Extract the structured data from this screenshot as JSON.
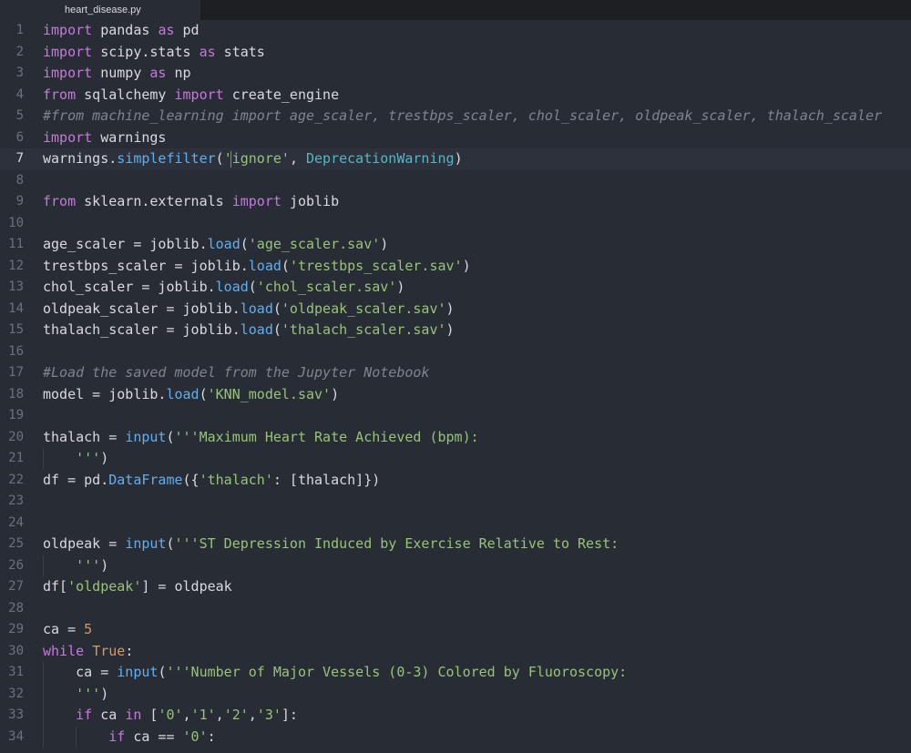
{
  "tab": {
    "filename": "heart_disease.py"
  },
  "editor": {
    "current_line": 7,
    "lines": [
      {
        "n": "1",
        "tokens": [
          [
            "kw",
            "import"
          ],
          [
            "tx",
            " pandas "
          ],
          [
            "kw",
            "as"
          ],
          [
            "tx",
            " pd"
          ]
        ]
      },
      {
        "n": "2",
        "tokens": [
          [
            "kw",
            "import"
          ],
          [
            "tx",
            " scipy.stats "
          ],
          [
            "kw",
            "as"
          ],
          [
            "tx",
            " stats"
          ]
        ]
      },
      {
        "n": "3",
        "tokens": [
          [
            "kw",
            "import"
          ],
          [
            "tx",
            " numpy "
          ],
          [
            "kw",
            "as"
          ],
          [
            "tx",
            " np"
          ]
        ]
      },
      {
        "n": "4",
        "tokens": [
          [
            "kw",
            "from"
          ],
          [
            "tx",
            " sqlalchemy "
          ],
          [
            "kw",
            "import"
          ],
          [
            "tx",
            " create_engine"
          ]
        ]
      },
      {
        "n": "5",
        "tokens": [
          [
            "cm",
            "#from machine_learning import age_scaler, trestbps_scaler, chol_scaler, oldpeak_scaler, thalach_scaler"
          ]
        ]
      },
      {
        "n": "6",
        "tokens": [
          [
            "kw",
            "import"
          ],
          [
            "tx",
            " warnings"
          ]
        ]
      },
      {
        "n": "7",
        "tokens": [
          [
            "tx",
            "warnings."
          ],
          [
            "fn",
            "simplefilter"
          ],
          [
            "tx",
            "("
          ],
          [
            "str",
            "'ignore'"
          ],
          [
            "tx",
            ", "
          ],
          [
            "cls",
            "DeprecationWarning"
          ],
          [
            "tx",
            ")"
          ]
        ]
      },
      {
        "n": "8",
        "tokens": []
      },
      {
        "n": "9",
        "tokens": [
          [
            "kw",
            "from"
          ],
          [
            "tx",
            " sklearn.externals "
          ],
          [
            "kw",
            "import"
          ],
          [
            "tx",
            " joblib"
          ]
        ]
      },
      {
        "n": "10",
        "tokens": []
      },
      {
        "n": "11",
        "tokens": [
          [
            "tx",
            "age_scaler = joblib."
          ],
          [
            "fn",
            "load"
          ],
          [
            "tx",
            "("
          ],
          [
            "str",
            "'age_scaler.sav'"
          ],
          [
            "tx",
            ")"
          ]
        ]
      },
      {
        "n": "12",
        "tokens": [
          [
            "tx",
            "trestbps_scaler = joblib."
          ],
          [
            "fn",
            "load"
          ],
          [
            "tx",
            "("
          ],
          [
            "str",
            "'trestbps_scaler.sav'"
          ],
          [
            "tx",
            ")"
          ]
        ]
      },
      {
        "n": "13",
        "tokens": [
          [
            "tx",
            "chol_scaler = joblib."
          ],
          [
            "fn",
            "load"
          ],
          [
            "tx",
            "("
          ],
          [
            "str",
            "'chol_scaler.sav'"
          ],
          [
            "tx",
            ")"
          ]
        ]
      },
      {
        "n": "14",
        "tokens": [
          [
            "tx",
            "oldpeak_scaler = joblib."
          ],
          [
            "fn",
            "load"
          ],
          [
            "tx",
            "("
          ],
          [
            "str",
            "'oldpeak_scaler.sav'"
          ],
          [
            "tx",
            ")"
          ]
        ]
      },
      {
        "n": "15",
        "tokens": [
          [
            "tx",
            "thalach_scaler = joblib."
          ],
          [
            "fn",
            "load"
          ],
          [
            "tx",
            "("
          ],
          [
            "str",
            "'thalach_scaler.sav'"
          ],
          [
            "tx",
            ")"
          ]
        ]
      },
      {
        "n": "16",
        "tokens": []
      },
      {
        "n": "17",
        "tokens": [
          [
            "cm",
            "#Load the saved model from the Jupyter Notebook"
          ]
        ]
      },
      {
        "n": "18",
        "tokens": [
          [
            "tx",
            "model = joblib."
          ],
          [
            "fn",
            "load"
          ],
          [
            "tx",
            "("
          ],
          [
            "str",
            "'KNN_model.sav'"
          ],
          [
            "tx",
            ")"
          ]
        ]
      },
      {
        "n": "19",
        "tokens": []
      },
      {
        "n": "20",
        "tokens": [
          [
            "tx",
            "thalach = "
          ],
          [
            "fn",
            "input"
          ],
          [
            "tx",
            "("
          ],
          [
            "str",
            "'''Maximum Heart Rate Achieved (bpm):"
          ]
        ]
      },
      {
        "n": "21",
        "tokens": [
          [
            "str",
            "    '''"
          ],
          [
            "tx",
            ")"
          ]
        ]
      },
      {
        "n": "22",
        "tokens": [
          [
            "tx",
            "df = pd."
          ],
          [
            "fn",
            "DataFrame"
          ],
          [
            "tx",
            "({"
          ],
          [
            "str",
            "'thalach'"
          ],
          [
            "tx",
            ": [thalach]})"
          ]
        ]
      },
      {
        "n": "23",
        "tokens": []
      },
      {
        "n": "24",
        "tokens": []
      },
      {
        "n": "25",
        "tokens": [
          [
            "tx",
            "oldpeak = "
          ],
          [
            "fn",
            "input"
          ],
          [
            "tx",
            "("
          ],
          [
            "str",
            "'''ST Depression Induced by Exercise Relative to Rest:"
          ]
        ]
      },
      {
        "n": "26",
        "tokens": [
          [
            "str",
            "    '''"
          ],
          [
            "tx",
            ")"
          ]
        ]
      },
      {
        "n": "27",
        "tokens": [
          [
            "tx",
            "df["
          ],
          [
            "str",
            "'oldpeak'"
          ],
          [
            "tx",
            "] = oldpeak"
          ]
        ]
      },
      {
        "n": "28",
        "tokens": []
      },
      {
        "n": "29",
        "tokens": [
          [
            "tx",
            "ca = "
          ],
          [
            "num",
            "5"
          ]
        ]
      },
      {
        "n": "30",
        "tokens": [
          [
            "kw",
            "while"
          ],
          [
            "tx",
            " "
          ],
          [
            "num",
            "True"
          ],
          [
            "tx",
            ":"
          ]
        ]
      },
      {
        "n": "31",
        "tokens": [
          [
            "tx",
            "    ca = "
          ],
          [
            "fn",
            "input"
          ],
          [
            "tx",
            "("
          ],
          [
            "str",
            "'''Number of Major Vessels (0-3) Colored by Fluoroscopy:"
          ]
        ]
      },
      {
        "n": "32",
        "tokens": [
          [
            "str",
            "    '''"
          ],
          [
            "tx",
            ")"
          ]
        ]
      },
      {
        "n": "33",
        "tokens": [
          [
            "tx",
            "    "
          ],
          [
            "kw",
            "if"
          ],
          [
            "tx",
            " ca "
          ],
          [
            "kw",
            "in"
          ],
          [
            "tx",
            " ["
          ],
          [
            "str",
            "'0'"
          ],
          [
            "tx",
            ","
          ],
          [
            "str",
            "'1'"
          ],
          [
            "tx",
            ","
          ],
          [
            "str",
            "'2'"
          ],
          [
            "tx",
            ","
          ],
          [
            "str",
            "'3'"
          ],
          [
            "tx",
            "]:"
          ]
        ]
      },
      {
        "n": "34",
        "tokens": [
          [
            "tx",
            "        "
          ],
          [
            "kw",
            "if"
          ],
          [
            "tx",
            " ca == "
          ],
          [
            "str",
            "'0'"
          ],
          [
            "tx",
            ":"
          ]
        ]
      }
    ]
  }
}
